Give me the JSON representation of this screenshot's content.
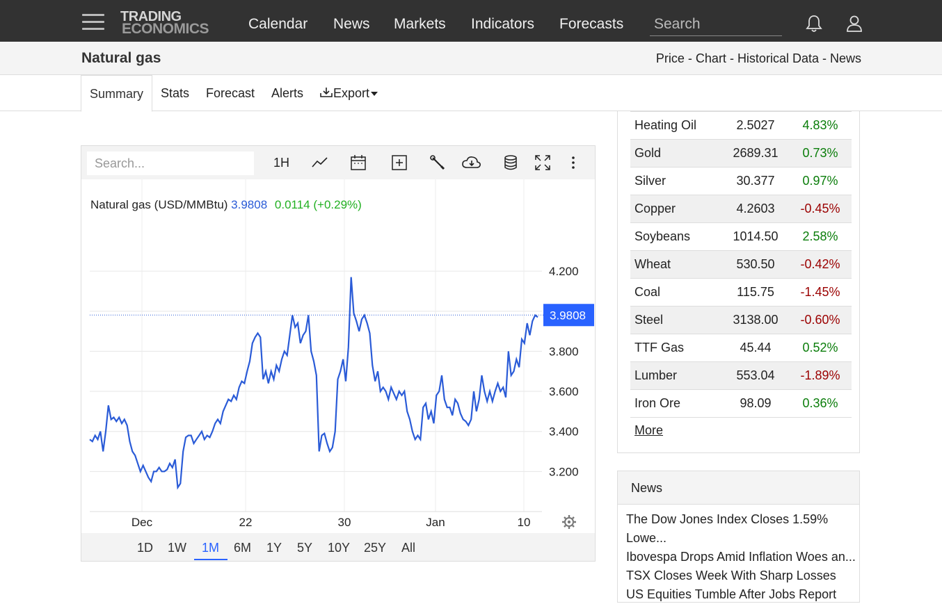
{
  "header": {
    "logo_line1": "TRADING",
    "logo_line2": "ECONOMICS",
    "nav": [
      "Calendar",
      "News",
      "Markets",
      "Indicators",
      "Forecasts"
    ],
    "search_placeholder": "Search",
    "icons": [
      "menu-icon",
      "bell-icon",
      "user-icon"
    ]
  },
  "subheader": {
    "title": "Natural gas",
    "links": [
      "Price",
      "Chart",
      "Historical Data",
      "News"
    ],
    "separator": " - "
  },
  "tabs": {
    "items": [
      "Summary",
      "Stats",
      "Forecast",
      "Alerts",
      "Export"
    ],
    "active": "Summary"
  },
  "chart_toolbar": {
    "search_placeholder": "Search...",
    "interval": "1H",
    "icons": [
      "line-chart-icon",
      "calendar-icon",
      "add-icon",
      "wrench-icon",
      "cloud-download-icon",
      "database-icon",
      "fullscreen-icon",
      "more-icon"
    ]
  },
  "chart_data": {
    "type": "line",
    "title": "Natural gas (USD/MMBtu)",
    "last_value": "3.9808",
    "change": "0.0114",
    "change_pct": "(+0.29%)",
    "last_label": "3.9808",
    "y_ticks": [
      "4.200",
      "3.800",
      "3.600",
      "3.400",
      "3.200"
    ],
    "x_ticks": [
      "Dec",
      "22",
      "30",
      "Jan",
      "10"
    ],
    "ylim": [
      3.0,
      4.45
    ],
    "series_color": "#2a5bd7",
    "series": [
      {
        "values": [
          3.36,
          3.35,
          3.38,
          3.36,
          3.4,
          3.3,
          3.4,
          3.53,
          3.46,
          3.47,
          3.45,
          3.47,
          3.44,
          3.46,
          3.43,
          3.35,
          3.3,
          3.28,
          3.24,
          3.2,
          3.23,
          3.2,
          3.17,
          3.15,
          3.2,
          3.2,
          3.22,
          3.2,
          3.2,
          3.21,
          3.24,
          3.22,
          3.26,
          3.12,
          3.14,
          3.3,
          3.37,
          3.38,
          3.38,
          3.34,
          3.36,
          3.38,
          3.4,
          3.36,
          3.38,
          3.37,
          3.4,
          3.44,
          3.46,
          3.44,
          3.5,
          3.53,
          3.56,
          3.55,
          3.58,
          3.56,
          3.62,
          3.65,
          3.64,
          3.7,
          3.75,
          3.84,
          3.87,
          3.89,
          3.87,
          3.66,
          3.7,
          3.64,
          3.7,
          3.66,
          3.73,
          3.7,
          3.76,
          3.8,
          3.78,
          3.88,
          3.98,
          3.92,
          3.94,
          3.84,
          3.88,
          3.9,
          3.98,
          3.8,
          3.75,
          3.68,
          3.3,
          3.38,
          3.39,
          3.34,
          3.3,
          3.32,
          3.4,
          3.66,
          3.7,
          3.76,
          3.65,
          3.82,
          4.17,
          3.99,
          3.95,
          3.9,
          3.96,
          3.98,
          3.94,
          3.89,
          3.73,
          3.65,
          3.7,
          3.6,
          3.62,
          3.6,
          3.56,
          3.62,
          3.59,
          3.56,
          3.6,
          3.58,
          3.6,
          3.5,
          3.46,
          3.4,
          3.36,
          3.38,
          3.36,
          3.52,
          3.54,
          3.46,
          3.5,
          3.44,
          3.58,
          3.6,
          3.68,
          3.56,
          3.52,
          3.52,
          3.48,
          3.56,
          3.54,
          3.49,
          3.46,
          3.45,
          3.43,
          3.46,
          3.6,
          3.5,
          3.56,
          3.68,
          3.6,
          3.55,
          3.6,
          3.55,
          3.6,
          3.64,
          3.6,
          3.62,
          3.57,
          3.8,
          3.68,
          3.7,
          3.76,
          3.72,
          3.86,
          3.84,
          3.94,
          3.88,
          3.95,
          3.98,
          3.97
        ]
      }
    ]
  },
  "range_buttons": {
    "items": [
      "1D",
      "1W",
      "1M",
      "6M",
      "1Y",
      "5Y",
      "10Y",
      "25Y",
      "All"
    ],
    "active": "1M"
  },
  "commodities": [
    {
      "name": "Heating Oil",
      "price": "2.5027",
      "change": "4.83%",
      "dir": "up"
    },
    {
      "name": "Gold",
      "price": "2689.31",
      "change": "0.73%",
      "dir": "up"
    },
    {
      "name": "Silver",
      "price": "30.377",
      "change": "0.97%",
      "dir": "up"
    },
    {
      "name": "Copper",
      "price": "4.2603",
      "change": "-0.45%",
      "dir": "down"
    },
    {
      "name": "Soybeans",
      "price": "1014.50",
      "change": "2.58%",
      "dir": "up"
    },
    {
      "name": "Wheat",
      "price": "530.50",
      "change": "-0.42%",
      "dir": "down"
    },
    {
      "name": "Coal",
      "price": "115.75",
      "change": "-1.45%",
      "dir": "down"
    },
    {
      "name": "Steel",
      "price": "3138.00",
      "change": "-0.60%",
      "dir": "down"
    },
    {
      "name": "TTF Gas",
      "price": "45.44",
      "change": "0.52%",
      "dir": "up"
    },
    {
      "name": "Lumber",
      "price": "553.04",
      "change": "-1.89%",
      "dir": "down"
    },
    {
      "name": "Iron Ore",
      "price": "98.09",
      "change": "0.36%",
      "dir": "up"
    }
  ],
  "more_label": "More",
  "news": {
    "heading": "News",
    "items": [
      "The Dow Jones Index Closes 1.59% Lowe...",
      "Ibovespa Drops Amid Inflation Woes an...",
      "TSX Closes Week With Sharp Losses",
      "US Equities Tumble After Jobs Report"
    ]
  }
}
